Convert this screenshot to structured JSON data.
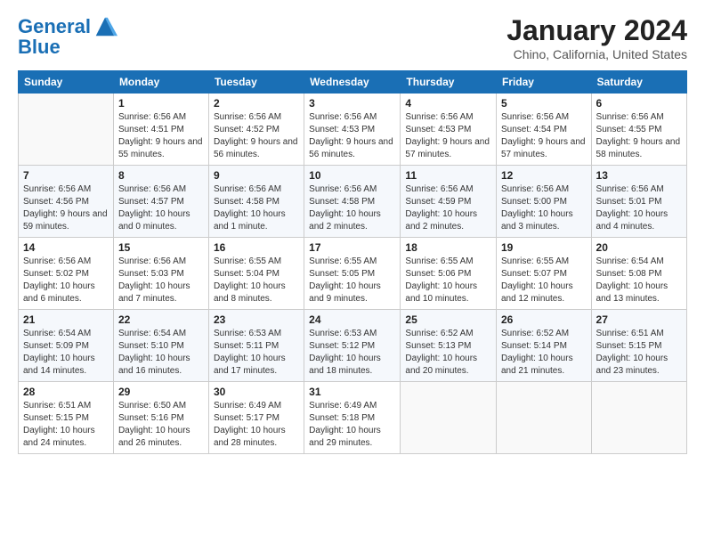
{
  "logo": {
    "line1": "General",
    "line2": "Blue"
  },
  "title": "January 2024",
  "location": "Chino, California, United States",
  "days_of_week": [
    "Sunday",
    "Monday",
    "Tuesday",
    "Wednesday",
    "Thursday",
    "Friday",
    "Saturday"
  ],
  "weeks": [
    [
      {
        "day": "",
        "sunrise": "",
        "sunset": "",
        "daylight": ""
      },
      {
        "day": "1",
        "sunrise": "Sunrise: 6:56 AM",
        "sunset": "Sunset: 4:51 PM",
        "daylight": "Daylight: 9 hours and 55 minutes."
      },
      {
        "day": "2",
        "sunrise": "Sunrise: 6:56 AM",
        "sunset": "Sunset: 4:52 PM",
        "daylight": "Daylight: 9 hours and 56 minutes."
      },
      {
        "day": "3",
        "sunrise": "Sunrise: 6:56 AM",
        "sunset": "Sunset: 4:53 PM",
        "daylight": "Daylight: 9 hours and 56 minutes."
      },
      {
        "day": "4",
        "sunrise": "Sunrise: 6:56 AM",
        "sunset": "Sunset: 4:53 PM",
        "daylight": "Daylight: 9 hours and 57 minutes."
      },
      {
        "day": "5",
        "sunrise": "Sunrise: 6:56 AM",
        "sunset": "Sunset: 4:54 PM",
        "daylight": "Daylight: 9 hours and 57 minutes."
      },
      {
        "day": "6",
        "sunrise": "Sunrise: 6:56 AM",
        "sunset": "Sunset: 4:55 PM",
        "daylight": "Daylight: 9 hours and 58 minutes."
      }
    ],
    [
      {
        "day": "7",
        "sunrise": "Sunrise: 6:56 AM",
        "sunset": "Sunset: 4:56 PM",
        "daylight": "Daylight: 9 hours and 59 minutes."
      },
      {
        "day": "8",
        "sunrise": "Sunrise: 6:56 AM",
        "sunset": "Sunset: 4:57 PM",
        "daylight": "Daylight: 10 hours and 0 minutes."
      },
      {
        "day": "9",
        "sunrise": "Sunrise: 6:56 AM",
        "sunset": "Sunset: 4:58 PM",
        "daylight": "Daylight: 10 hours and 1 minute."
      },
      {
        "day": "10",
        "sunrise": "Sunrise: 6:56 AM",
        "sunset": "Sunset: 4:58 PM",
        "daylight": "Daylight: 10 hours and 2 minutes."
      },
      {
        "day": "11",
        "sunrise": "Sunrise: 6:56 AM",
        "sunset": "Sunset: 4:59 PM",
        "daylight": "Daylight: 10 hours and 2 minutes."
      },
      {
        "day": "12",
        "sunrise": "Sunrise: 6:56 AM",
        "sunset": "Sunset: 5:00 PM",
        "daylight": "Daylight: 10 hours and 3 minutes."
      },
      {
        "day": "13",
        "sunrise": "Sunrise: 6:56 AM",
        "sunset": "Sunset: 5:01 PM",
        "daylight": "Daylight: 10 hours and 4 minutes."
      }
    ],
    [
      {
        "day": "14",
        "sunrise": "Sunrise: 6:56 AM",
        "sunset": "Sunset: 5:02 PM",
        "daylight": "Daylight: 10 hours and 6 minutes."
      },
      {
        "day": "15",
        "sunrise": "Sunrise: 6:56 AM",
        "sunset": "Sunset: 5:03 PM",
        "daylight": "Daylight: 10 hours and 7 minutes."
      },
      {
        "day": "16",
        "sunrise": "Sunrise: 6:55 AM",
        "sunset": "Sunset: 5:04 PM",
        "daylight": "Daylight: 10 hours and 8 minutes."
      },
      {
        "day": "17",
        "sunrise": "Sunrise: 6:55 AM",
        "sunset": "Sunset: 5:05 PM",
        "daylight": "Daylight: 10 hours and 9 minutes."
      },
      {
        "day": "18",
        "sunrise": "Sunrise: 6:55 AM",
        "sunset": "Sunset: 5:06 PM",
        "daylight": "Daylight: 10 hours and 10 minutes."
      },
      {
        "day": "19",
        "sunrise": "Sunrise: 6:55 AM",
        "sunset": "Sunset: 5:07 PM",
        "daylight": "Daylight: 10 hours and 12 minutes."
      },
      {
        "day": "20",
        "sunrise": "Sunrise: 6:54 AM",
        "sunset": "Sunset: 5:08 PM",
        "daylight": "Daylight: 10 hours and 13 minutes."
      }
    ],
    [
      {
        "day": "21",
        "sunrise": "Sunrise: 6:54 AM",
        "sunset": "Sunset: 5:09 PM",
        "daylight": "Daylight: 10 hours and 14 minutes."
      },
      {
        "day": "22",
        "sunrise": "Sunrise: 6:54 AM",
        "sunset": "Sunset: 5:10 PM",
        "daylight": "Daylight: 10 hours and 16 minutes."
      },
      {
        "day": "23",
        "sunrise": "Sunrise: 6:53 AM",
        "sunset": "Sunset: 5:11 PM",
        "daylight": "Daylight: 10 hours and 17 minutes."
      },
      {
        "day": "24",
        "sunrise": "Sunrise: 6:53 AM",
        "sunset": "Sunset: 5:12 PM",
        "daylight": "Daylight: 10 hours and 18 minutes."
      },
      {
        "day": "25",
        "sunrise": "Sunrise: 6:52 AM",
        "sunset": "Sunset: 5:13 PM",
        "daylight": "Daylight: 10 hours and 20 minutes."
      },
      {
        "day": "26",
        "sunrise": "Sunrise: 6:52 AM",
        "sunset": "Sunset: 5:14 PM",
        "daylight": "Daylight: 10 hours and 21 minutes."
      },
      {
        "day": "27",
        "sunrise": "Sunrise: 6:51 AM",
        "sunset": "Sunset: 5:15 PM",
        "daylight": "Daylight: 10 hours and 23 minutes."
      }
    ],
    [
      {
        "day": "28",
        "sunrise": "Sunrise: 6:51 AM",
        "sunset": "Sunset: 5:15 PM",
        "daylight": "Daylight: 10 hours and 24 minutes."
      },
      {
        "day": "29",
        "sunrise": "Sunrise: 6:50 AM",
        "sunset": "Sunset: 5:16 PM",
        "daylight": "Daylight: 10 hours and 26 minutes."
      },
      {
        "day": "30",
        "sunrise": "Sunrise: 6:49 AM",
        "sunset": "Sunset: 5:17 PM",
        "daylight": "Daylight: 10 hours and 28 minutes."
      },
      {
        "day": "31",
        "sunrise": "Sunrise: 6:49 AM",
        "sunset": "Sunset: 5:18 PM",
        "daylight": "Daylight: 10 hours and 29 minutes."
      },
      {
        "day": "",
        "sunrise": "",
        "sunset": "",
        "daylight": ""
      },
      {
        "day": "",
        "sunrise": "",
        "sunset": "",
        "daylight": ""
      },
      {
        "day": "",
        "sunrise": "",
        "sunset": "",
        "daylight": ""
      }
    ]
  ]
}
